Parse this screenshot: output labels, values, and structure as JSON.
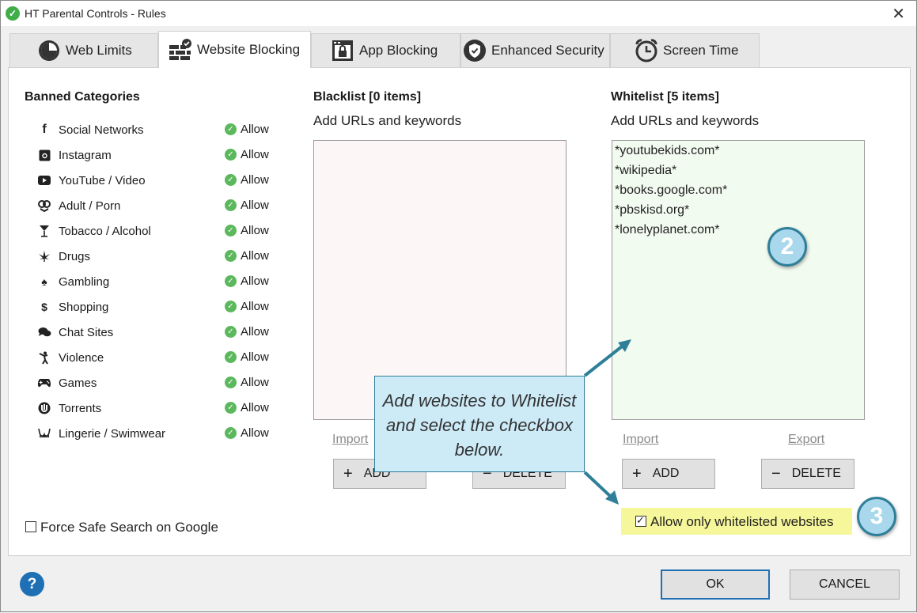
{
  "window": {
    "title": "HT Parental Controls - Rules"
  },
  "tabs": [
    {
      "label": "Web Limits",
      "icon": "clock-half-icon"
    },
    {
      "label": "Website Blocking",
      "icon": "wall-check-icon"
    },
    {
      "label": "App Blocking",
      "icon": "app-lock-icon"
    },
    {
      "label": "Enhanced Security",
      "icon": "shield-check-icon"
    },
    {
      "label": "Screen Time",
      "icon": "alarm-clock-icon"
    }
  ],
  "active_tab": "Website Blocking",
  "banned": {
    "title": "Banned Categories",
    "items": [
      {
        "label": "Social Networks",
        "icon": "facebook-icon",
        "status": "Allow"
      },
      {
        "label": "Instagram",
        "icon": "instagram-icon",
        "status": "Allow"
      },
      {
        "label": "YouTube / Video",
        "icon": "youtube-icon",
        "status": "Allow"
      },
      {
        "label": "Adult / Porn",
        "icon": "adult-icon",
        "status": "Allow"
      },
      {
        "label": "Tobacco / Alcohol",
        "icon": "cocktail-icon",
        "status": "Allow"
      },
      {
        "label": "Drugs",
        "icon": "cannabis-leaf-icon",
        "status": "Allow"
      },
      {
        "label": "Gambling",
        "icon": "spade-icon",
        "status": "Allow"
      },
      {
        "label": "Shopping",
        "icon": "dollar-icon",
        "status": "Allow"
      },
      {
        "label": "Chat Sites",
        "icon": "chat-bubbles-icon",
        "status": "Allow"
      },
      {
        "label": "Violence",
        "icon": "fighter-icon",
        "status": "Allow"
      },
      {
        "label": "Games",
        "icon": "gamepad-icon",
        "status": "Allow"
      },
      {
        "label": "Torrents",
        "icon": "torrent-icon",
        "status": "Allow"
      },
      {
        "label": "Lingerie / Swimwear",
        "icon": "lingerie-icon",
        "status": "Allow"
      }
    ]
  },
  "blacklist": {
    "title": "Blacklist [0 items]",
    "subtitle": "Add URLs and keywords",
    "items": [],
    "import_label": "Import",
    "add_label": "ADD",
    "delete_label": "DELETE"
  },
  "whitelist": {
    "title": "Whitelist [5 items]",
    "subtitle": "Add URLs and keywords",
    "items": [
      "*youtubekids.com*",
      "*wikipedia*",
      "*books.google.com*",
      "*pbskisd.org*",
      "*lonelyplanet.com*"
    ],
    "import_label": "Import",
    "export_label": "Export",
    "add_label": "ADD",
    "delete_label": "DELETE",
    "only_whitelisted_label": "Allow only whitelisted websites",
    "only_whitelisted_checked": true
  },
  "safe_search": {
    "label": "Force Safe Search on Google",
    "checked": false
  },
  "callout": {
    "text": "Add websites to Whitelist and select the checkbox below."
  },
  "badges": {
    "two": "2",
    "three": "3"
  },
  "buttons": {
    "ok": "OK",
    "cancel": "CANCEL",
    "help": "?"
  },
  "colors": {
    "blacklist_bg": "#fdf6f6",
    "whitelist_bg": "#f2fbf0",
    "allow_check": "#5cb85c",
    "callout_bg": "#cdeaf7",
    "accent": "#2f7f99",
    "highlight": "#f6f69a"
  }
}
